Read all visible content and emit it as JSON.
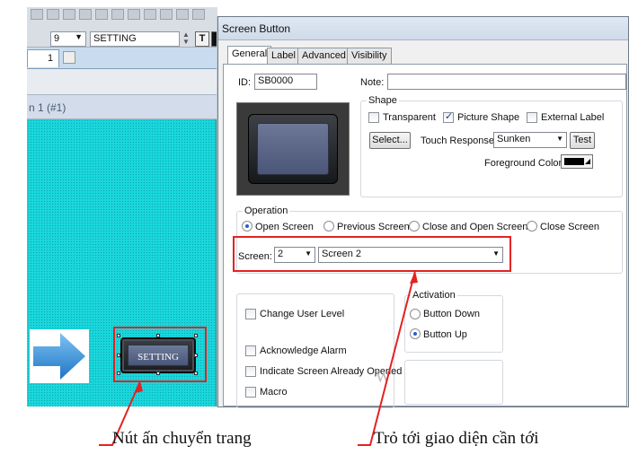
{
  "editor": {
    "font_size": "9",
    "font_name": "SETTING",
    "bold_label": "T",
    "doc_tab": "1",
    "doc_title": "n 1 (#1)",
    "canvas_button_label": "SETTING",
    "icons": [
      "arrow-right-icon",
      "spin-icon",
      "bold-toggle-icon",
      "fill-color-icon"
    ],
    "canvas_color": "#19d7dc",
    "arrow_color": "#2f8fd6"
  },
  "dialog": {
    "title": "Screen Button",
    "tabs": [
      {
        "label": "General",
        "active": true
      },
      {
        "label": "Label",
        "active": false
      },
      {
        "label": "Advanced",
        "active": false
      },
      {
        "label": "Visibility",
        "active": false
      }
    ],
    "id_label": "ID:",
    "id_value": "SB0000",
    "note_label": "Note:",
    "note_value": "",
    "shape": {
      "title": "Shape",
      "transparent_label": "Transparent",
      "transparent_checked": false,
      "picture_shape_label": "Picture Shape",
      "picture_shape_checked": true,
      "external_label_label": "External Label",
      "external_label_checked": false,
      "select_button": "Select...",
      "touch_response_label": "Touch Response:",
      "touch_response_value": "Sunken",
      "test_button": "Test",
      "foreground_color_label": "Foreground Color:"
    },
    "operation": {
      "title": "Operation",
      "options": [
        {
          "label": "Open Screen",
          "selected": true
        },
        {
          "label": "Previous Screen",
          "selected": false
        },
        {
          "label": "Close and Open Screen",
          "selected": false
        },
        {
          "label": "Close Screen",
          "selected": false
        }
      ],
      "screen_label": "Screen:",
      "screen_number": "2",
      "screen_name": "Screen 2"
    },
    "options": {
      "change_user_level": "Change User Level",
      "acknowledge_alarm": "Acknowledge Alarm",
      "indicate_screen_opened": "Indicate Screen Already Opened",
      "macro": "Macro"
    },
    "activation": {
      "title": "Activation",
      "options": [
        {
          "label": "Button Down",
          "selected": false
        },
        {
          "label": "Button Up",
          "selected": true
        }
      ]
    },
    "watermark": "W"
  },
  "annotations": {
    "left_caption": "Nút ấn chuyển trang",
    "right_caption": "Trỏ tới giao diện cần tới",
    "highlight_color": "#e32222"
  }
}
